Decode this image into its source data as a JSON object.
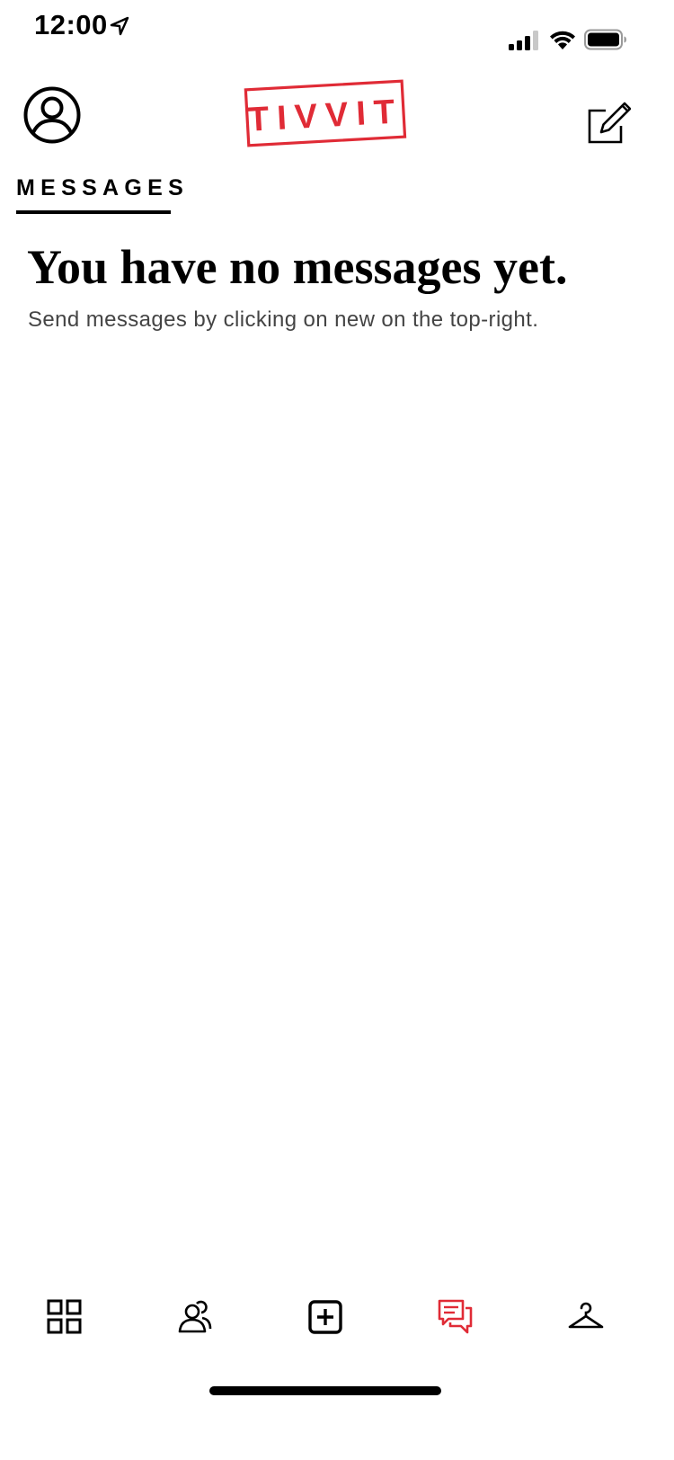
{
  "status_bar": {
    "time": "12:00"
  },
  "header": {
    "logo_text": "TIVVIT",
    "brand_color": "#e02b36"
  },
  "tabs": [
    {
      "label": "MESSAGES",
      "active": true
    }
  ],
  "empty_state": {
    "title": "You have no messages yet.",
    "subtitle": "Send messages by clicking on new on the top-right."
  },
  "bottom_nav": {
    "items": [
      {
        "icon": "grid-icon",
        "active": false
      },
      {
        "icon": "people-icon",
        "active": false
      },
      {
        "icon": "add-square-icon",
        "active": false
      },
      {
        "icon": "chat-bubbles-icon",
        "active": true
      },
      {
        "icon": "hanger-icon",
        "active": false
      }
    ],
    "active_color": "#e02b36",
    "inactive_color": "#000000"
  }
}
